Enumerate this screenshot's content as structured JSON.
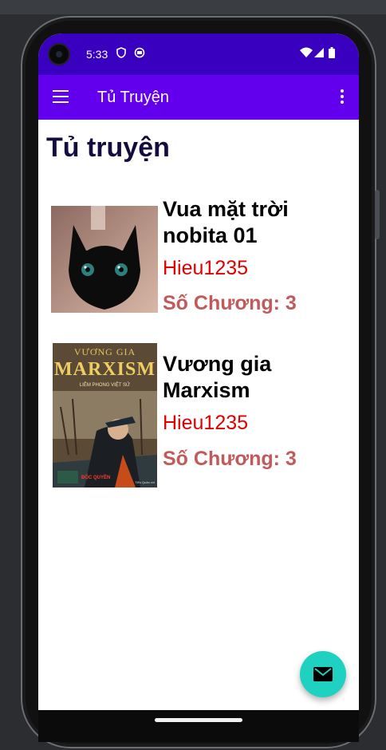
{
  "status_bar": {
    "time": "5:33"
  },
  "app_bar": {
    "title": "Tủ Truyện"
  },
  "page": {
    "title": "Tủ truyện"
  },
  "stories": [
    {
      "name": " Vua mặt trời nobita 01",
      "author": "Hieu1235",
      "chapters": "Số Chương: 3"
    },
    {
      "name": "Vương gia Marxism",
      "author": "Hieu1235",
      "chapters": "Số Chương: 3",
      "cover_text": {
        "top": "VƯƠNG GIA",
        "main": "MARXISM",
        "sub": "LIÊM PHONG VIỆT SỬ",
        "badge": "ĐỘC QUYỀN",
        "corner": "Tiểu Quân rớt"
      }
    }
  ],
  "colors": {
    "status_bar": "#3a00c0",
    "app_bar": "#6200ee",
    "page_title": "#140b3e",
    "author": "#e00000",
    "chapters": "#c15a5a",
    "fab": "#1fd1c1"
  },
  "icons": {
    "menu": "hamburger-icon",
    "more": "more-vert-icon",
    "fab": "mail-icon"
  }
}
